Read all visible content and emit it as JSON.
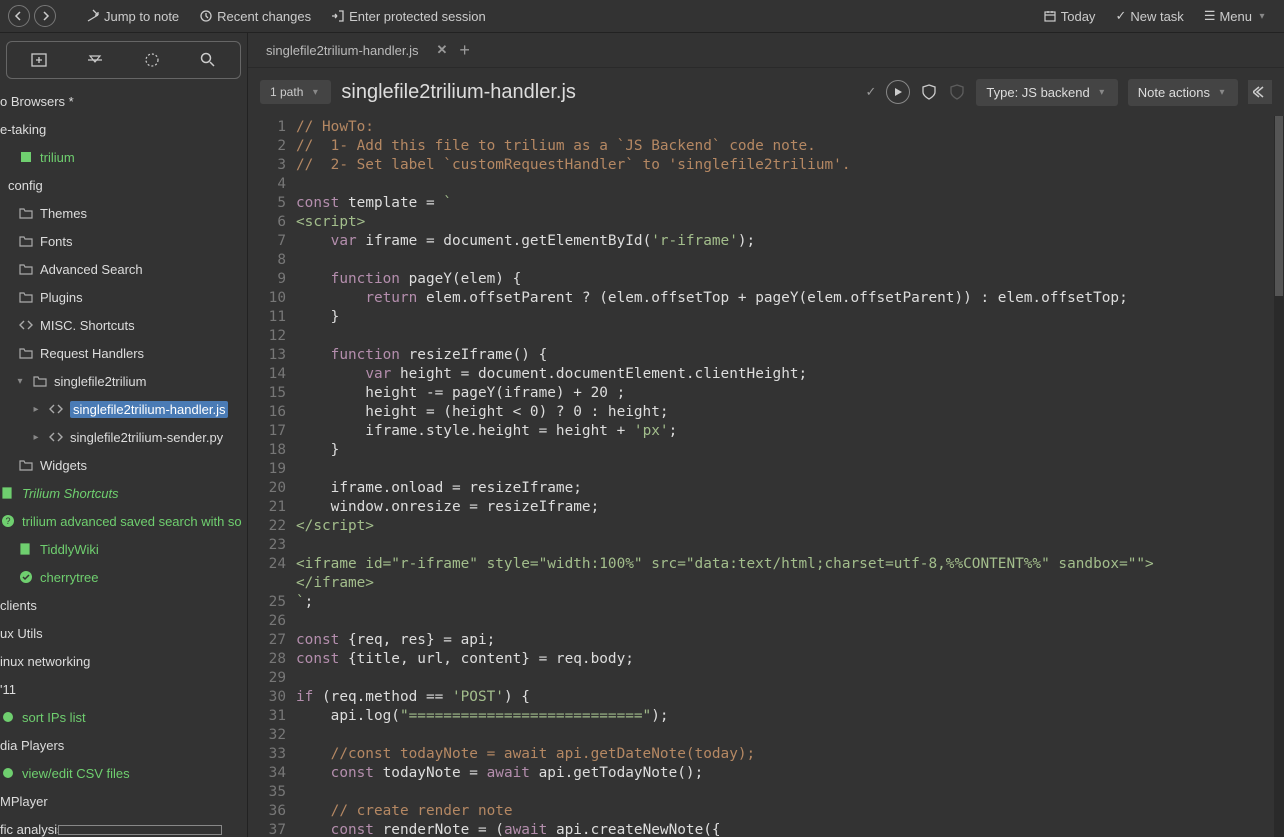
{
  "topbar": {
    "jump": "Jump to note",
    "recent": "Recent changes",
    "protected": "Enter protected session",
    "today": "Today",
    "newtask": "New task",
    "menu": "Menu"
  },
  "tab": {
    "title": "singlefile2trilium-handler.js"
  },
  "title": {
    "path": "1 path",
    "name": "singlefile2trilium-handler.js",
    "type": "Type: JS backend",
    "actions": "Note actions"
  },
  "tree": [
    {
      "ind": 0,
      "icon": "",
      "label": "o Browsers *",
      "cls": ""
    },
    {
      "ind": 0,
      "icon": "",
      "label": "e-taking",
      "cls": "",
      "hr": true
    },
    {
      "ind": 0,
      "icon": "t",
      "label": "trilium",
      "cls": "green",
      "chev": ""
    },
    {
      "ind": 8,
      "icon": "",
      "label": "config",
      "cls": ""
    },
    {
      "ind": 0,
      "icon": "folder",
      "label": "Themes",
      "cls": "",
      "chev": ""
    },
    {
      "ind": 0,
      "icon": "folder",
      "label": "Fonts",
      "cls": "",
      "chev": ""
    },
    {
      "ind": 0,
      "icon": "folder",
      "label": "Advanced Search",
      "cls": "",
      "chev": ""
    },
    {
      "ind": 0,
      "icon": "folder",
      "label": "Plugins",
      "cls": "",
      "chev": ""
    },
    {
      "ind": 0,
      "icon": "code",
      "label": "MISC. Shortcuts",
      "cls": "",
      "chev": ""
    },
    {
      "ind": 0,
      "icon": "folder",
      "label": "Request Handlers",
      "cls": "",
      "chev": ""
    },
    {
      "ind": 14,
      "icon": "folder",
      "label": "singlefile2trilium",
      "cls": "",
      "chev": "v"
    },
    {
      "ind": 30,
      "icon": "code",
      "label": "singlefile2trilium-handler.js",
      "cls": "selected",
      "chev": ">"
    },
    {
      "ind": 30,
      "icon": "code",
      "label": "singlefile2trilium-sender.py",
      "cls": "",
      "chev": ">"
    },
    {
      "ind": 0,
      "icon": "folder",
      "label": "Widgets",
      "cls": "",
      "chev": ""
    },
    {
      "ind": 0,
      "icon": "book",
      "label": "Trilium Shortcuts",
      "cls": "green italic"
    },
    {
      "ind": 0,
      "icon": "q",
      "label": "trilium advanced saved search with so",
      "cls": "green"
    },
    {
      "ind": 0,
      "icon": "book",
      "label": "TiddlyWiki",
      "cls": "green",
      "chev": ""
    },
    {
      "ind": 0,
      "icon": "check",
      "label": "cherrytree",
      "cls": "green",
      "chev": ""
    },
    {
      "ind": 0,
      "icon": "",
      "label": "clients",
      "cls": "",
      "hr": true
    },
    {
      "ind": 0,
      "icon": "",
      "label": "ux Utils",
      "cls": ""
    },
    {
      "ind": 0,
      "icon": "",
      "label": "inux networking",
      "cls": ""
    },
    {
      "ind": 0,
      "icon": "",
      "label": "'11",
      "cls": ""
    },
    {
      "ind": 0,
      "icon": "dot",
      "label": "sort IPs list",
      "cls": "green"
    },
    {
      "ind": 0,
      "icon": "",
      "label": "dia Players",
      "cls": ""
    },
    {
      "ind": 0,
      "icon": "dot",
      "label": "view/edit CSV files",
      "cls": "green"
    },
    {
      "ind": 0,
      "icon": "",
      "label": "MPlayer",
      "cls": ""
    },
    {
      "ind": 0,
      "icon": "",
      "label": "fic analysis",
      "cls": ""
    }
  ],
  "code": [
    {
      "n": 1,
      "seg": [
        {
          "c": "c-comment",
          "t": "// HowTo:"
        }
      ]
    },
    {
      "n": 2,
      "seg": [
        {
          "c": "c-comment",
          "t": "//  1- Add this file to trilium as a `JS Backend` code note."
        }
      ]
    },
    {
      "n": 3,
      "seg": [
        {
          "c": "c-comment",
          "t": "//  2- Set label `customRequestHandler` to 'singlefile2trilium'."
        }
      ]
    },
    {
      "n": 4,
      "seg": []
    },
    {
      "n": 5,
      "seg": [
        {
          "c": "c-kw",
          "t": "const"
        },
        {
          "c": "",
          "t": " template = "
        },
        {
          "c": "c-str",
          "t": "`"
        }
      ]
    },
    {
      "n": 6,
      "seg": [
        {
          "c": "c-tag",
          "t": "<script>"
        }
      ]
    },
    {
      "n": 7,
      "seg": [
        {
          "c": "",
          "t": "    "
        },
        {
          "c": "c-kw",
          "t": "var"
        },
        {
          "c": "",
          "t": " iframe = document.getElementById("
        },
        {
          "c": "c-str",
          "t": "'r-iframe'"
        },
        {
          "c": "",
          "t": ");"
        }
      ]
    },
    {
      "n": 8,
      "seg": []
    },
    {
      "n": 9,
      "seg": [
        {
          "c": "",
          "t": "    "
        },
        {
          "c": "c-kw",
          "t": "function"
        },
        {
          "c": "",
          "t": " pageY(elem) {"
        }
      ]
    },
    {
      "n": 10,
      "seg": [
        {
          "c": "",
          "t": "        "
        },
        {
          "c": "c-kw",
          "t": "return"
        },
        {
          "c": "",
          "t": " elem.offsetParent ? (elem.offsetTop + pageY(elem.offsetParent)) : elem.offsetTop;"
        }
      ]
    },
    {
      "n": 11,
      "seg": [
        {
          "c": "",
          "t": "    }"
        }
      ]
    },
    {
      "n": 12,
      "seg": []
    },
    {
      "n": 13,
      "seg": [
        {
          "c": "",
          "t": "    "
        },
        {
          "c": "c-kw",
          "t": "function"
        },
        {
          "c": "",
          "t": " resizeIframe() {"
        }
      ]
    },
    {
      "n": 14,
      "seg": [
        {
          "c": "",
          "t": "        "
        },
        {
          "c": "c-kw",
          "t": "var"
        },
        {
          "c": "",
          "t": " height = document.documentElement.clientHeight;"
        }
      ]
    },
    {
      "n": 15,
      "seg": [
        {
          "c": "",
          "t": "        height -= pageY(iframe) + 20 ;"
        }
      ]
    },
    {
      "n": 16,
      "seg": [
        {
          "c": "",
          "t": "        height = (height < 0) ? 0 : height;"
        }
      ]
    },
    {
      "n": 17,
      "seg": [
        {
          "c": "",
          "t": "        iframe.style.height = height + "
        },
        {
          "c": "c-str",
          "t": "'px'"
        },
        {
          "c": "",
          "t": ";"
        }
      ]
    },
    {
      "n": 18,
      "seg": [
        {
          "c": "",
          "t": "    }"
        }
      ]
    },
    {
      "n": 19,
      "seg": []
    },
    {
      "n": 20,
      "seg": [
        {
          "c": "",
          "t": "    iframe.onload = resizeIframe;"
        }
      ]
    },
    {
      "n": 21,
      "seg": [
        {
          "c": "",
          "t": "    window.onresize = resizeIframe;"
        }
      ]
    },
    {
      "n": 22,
      "seg": [
        {
          "c": "c-tag",
          "t": "</script>"
        }
      ]
    },
    {
      "n": 23,
      "seg": []
    },
    {
      "n": 24,
      "seg": [
        {
          "c": "c-tag",
          "t": "<iframe id=\"r-iframe\" style=\"width:100%\" src=\"data:text/html;charset=utf-8,%%CONTENT%%\" sandbox=\"\">"
        }
      ]
    },
    {
      "n": "",
      "seg": [
        {
          "c": "c-tag",
          "t": "</iframe>"
        }
      ]
    },
    {
      "n": 25,
      "seg": [
        {
          "c": "c-str",
          "t": "`"
        },
        {
          "c": "",
          "t": ";"
        }
      ]
    },
    {
      "n": 26,
      "seg": []
    },
    {
      "n": 27,
      "seg": [
        {
          "c": "c-kw",
          "t": "const"
        },
        {
          "c": "",
          "t": " {req, res} = api;"
        }
      ]
    },
    {
      "n": 28,
      "seg": [
        {
          "c": "c-kw",
          "t": "const"
        },
        {
          "c": "",
          "t": " {title, url, content} = req.body;"
        }
      ]
    },
    {
      "n": 29,
      "seg": []
    },
    {
      "n": 30,
      "seg": [
        {
          "c": "c-kw",
          "t": "if"
        },
        {
          "c": "",
          "t": " (req.method == "
        },
        {
          "c": "c-str",
          "t": "'POST'"
        },
        {
          "c": "",
          "t": ") {"
        }
      ]
    },
    {
      "n": 31,
      "seg": [
        {
          "c": "",
          "t": "    api.log("
        },
        {
          "c": "c-str",
          "t": "\"===========================\""
        },
        {
          "c": "",
          "t": ");"
        }
      ]
    },
    {
      "n": 32,
      "seg": []
    },
    {
      "n": 33,
      "seg": [
        {
          "c": "",
          "t": "    "
        },
        {
          "c": "c-comment",
          "t": "//const todayNote = await api.getDateNote(today);"
        }
      ]
    },
    {
      "n": 34,
      "err": true,
      "seg": [
        {
          "c": "",
          "t": "    "
        },
        {
          "c": "c-kw",
          "t": "const"
        },
        {
          "c": "",
          "t": " todayNote = "
        },
        {
          "c": "c-kw",
          "t": "await"
        },
        {
          "c": "",
          "t": " api.getTodayNote();"
        }
      ]
    },
    {
      "n": 35,
      "seg": []
    },
    {
      "n": 36,
      "seg": [
        {
          "c": "",
          "t": "    "
        },
        {
          "c": "c-comment",
          "t": "// create render note"
        }
      ]
    },
    {
      "n": 37,
      "seg": [
        {
          "c": "",
          "t": "    "
        },
        {
          "c": "c-kw",
          "t": "const"
        },
        {
          "c": "",
          "t": " renderNote = ("
        },
        {
          "c": "c-kw",
          "t": "await"
        },
        {
          "c": "",
          "t": " api.createNewNote({"
        }
      ]
    }
  ]
}
